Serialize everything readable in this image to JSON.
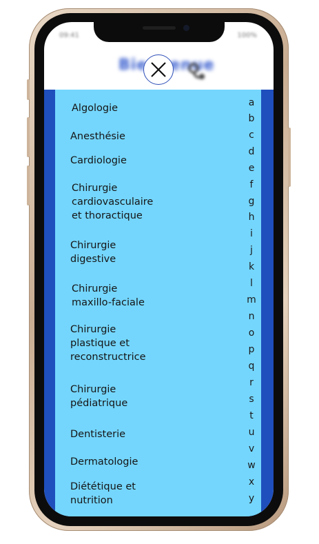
{
  "app": {
    "status_time": "09:41",
    "status_battery": "100%",
    "header_title": "Bienvenue",
    "header_icon": "stethoscope-icon",
    "close_icon": "close-icon"
  },
  "specialties": [
    "Algologie",
    "Anesthésie",
    "Cardiologie",
    "Chirurgie\ncardiovasculaire\net thoractique",
    "Chirurgie\ndigestive",
    "Chirurgie\nmaxillo-faciale",
    "Chirurgie\nplastique et\nreconstructrice",
    "Chirurgie\npédiatrique",
    "Dentisterie",
    "Dermatologie",
    "Diététique et\nnutrition"
  ],
  "alphabet": [
    "a",
    "b",
    "c",
    "d",
    "e",
    "f",
    "g",
    "h",
    "i",
    "j",
    "k",
    "l",
    "m",
    "n",
    "o",
    "p",
    "q",
    "r",
    "s",
    "t",
    "u",
    "v",
    "w",
    "x",
    "y"
  ],
  "colors": {
    "panel_border": "#1f4fbd",
    "list_background": "#74d6fd",
    "phone_frame": "#d8c2aa"
  }
}
